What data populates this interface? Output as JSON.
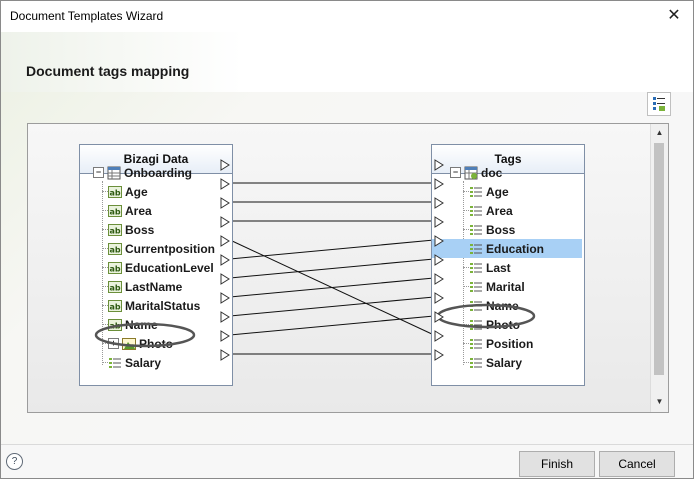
{
  "window": {
    "title": "Document Templates Wizard",
    "close_glyph": "✕"
  },
  "section_title": "Document tags mapping",
  "help_glyph": "?",
  "left_panel": {
    "header": "Bizagi Data",
    "root": "Onboarding",
    "items": [
      "Age",
      "Area",
      "Boss",
      "Currentposition",
      "EducationLevel",
      "LastName",
      "MaritalStatus",
      "Name",
      "Photo",
      "Salary"
    ]
  },
  "right_panel": {
    "header": "Tags",
    "root": "doc",
    "items": [
      "Age",
      "Area",
      "Boss",
      "Education",
      "Last",
      "Marital",
      "Name",
      "Photo",
      "Position",
      "Salary"
    ],
    "selected": "Education"
  },
  "mappings": [
    [
      "Age",
      "Age"
    ],
    [
      "Area",
      "Area"
    ],
    [
      "Boss",
      "Boss"
    ],
    [
      "Currentposition",
      "Position"
    ],
    [
      "EducationLevel",
      "Education"
    ],
    [
      "LastName",
      "Last"
    ],
    [
      "MaritalStatus",
      "Marital"
    ],
    [
      "Name",
      "Name"
    ],
    [
      "Photo",
      "Photo"
    ],
    [
      "Salary",
      "Salary"
    ]
  ],
  "highlights": [
    "Photo (left)",
    "Photo (right)"
  ],
  "icons": {
    "close": "close-icon",
    "layout": "layout-icon",
    "help": "help-icon",
    "entity": "entity-table-icon",
    "text_attr": "text-attribute-icon",
    "image_attr": "image-attribute-icon",
    "tag": "tag-field-icon"
  },
  "colors": {
    "selected_row": "#a8d0f5",
    "panel_border": "#7f8fa6",
    "highlight_ring": "#555555"
  },
  "buttons": {
    "finish": "Finish",
    "cancel": "Cancel"
  }
}
